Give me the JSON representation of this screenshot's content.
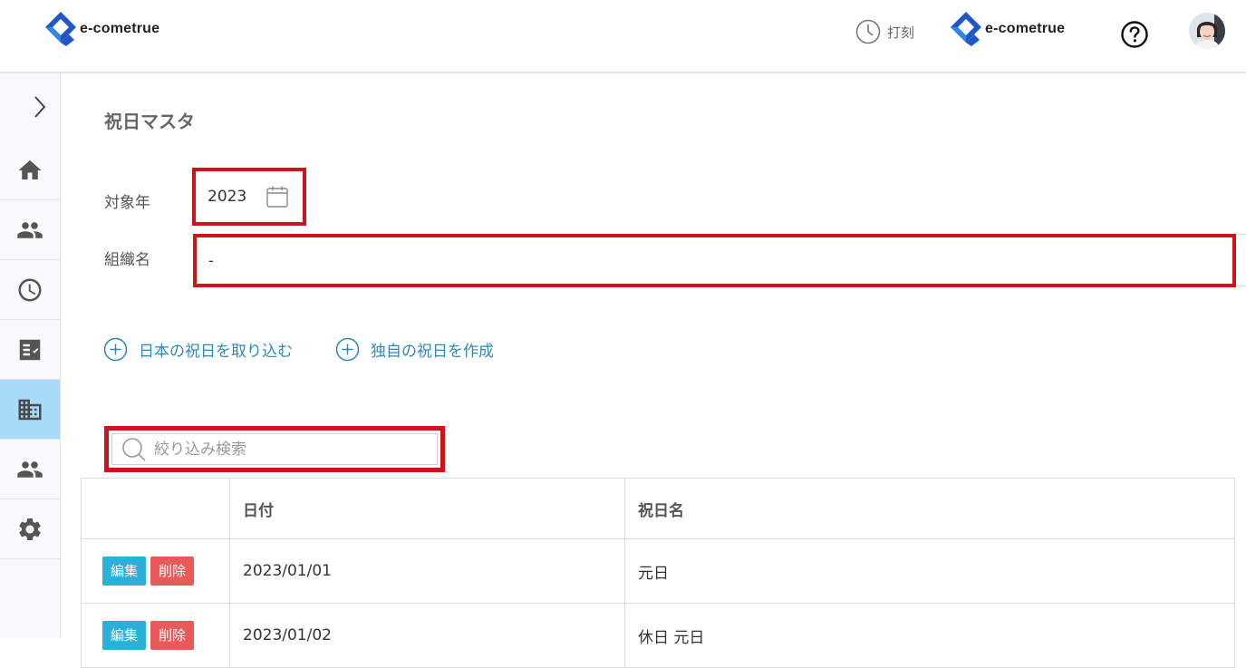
{
  "header": {
    "brand_left": "e-cometrue",
    "punch_label": "打刻",
    "brand_right": "e-cometrue",
    "help_icon": "question-circle-icon",
    "avatar": "user-avatar"
  },
  "sidebar": {
    "toggle_icon": "chevron-right-icon",
    "items": [
      {
        "icon": "home-icon",
        "active": false
      },
      {
        "icon": "people-icon",
        "active": false
      },
      {
        "icon": "clock-icon",
        "active": false
      },
      {
        "icon": "checklist-icon",
        "active": false
      },
      {
        "icon": "building-icon",
        "active": true
      },
      {
        "icon": "people-icon",
        "active": false
      },
      {
        "icon": "gear-icon",
        "active": false
      }
    ]
  },
  "page": {
    "title": "祝日マスタ",
    "year_label": "対象年",
    "year_value": "2023",
    "org_label": "組織名",
    "org_value": "-",
    "actions": {
      "import_label": "日本の祝日を取り込む",
      "create_label": "独自の祝日を作成"
    },
    "search": {
      "placeholder": "絞り込み検索"
    }
  },
  "table": {
    "columns": [
      "",
      "日付",
      "祝日名"
    ],
    "edit_label": "編集",
    "delete_label": "削除",
    "rows": [
      {
        "date": "2023/01/01",
        "name": "元日"
      },
      {
        "date": "2023/01/02",
        "name": "休日 元日"
      }
    ]
  },
  "colors": {
    "accent_blue": "#2a8ab8",
    "active_sidebar": "#a6dcfa",
    "highlight_red": "#d0121b",
    "edit_button": "#2bb0d9",
    "delete_button": "#e85a5a"
  }
}
